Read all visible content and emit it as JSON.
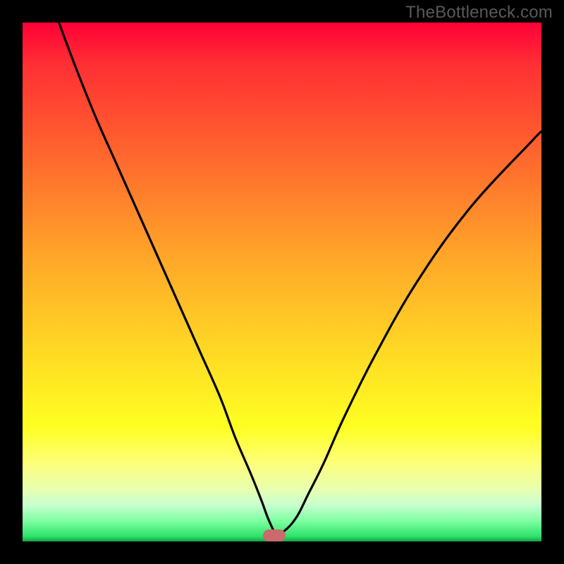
{
  "watermark": "TheBottleneck.com",
  "colors": {
    "frame": "#000000",
    "watermark": "#595959",
    "curve_stroke": "#000000",
    "bump": "#cb6a6c",
    "gradient_stops": [
      "#ff0037",
      "#ff2f34",
      "#ff5b2f",
      "#ffa629",
      "#ffe024",
      "#ffff22",
      "#fdff7b",
      "#e7ffb1",
      "#c7ffce",
      "#7fffa2",
      "#2de36b",
      "#16a342"
    ]
  },
  "chart_data": {
    "type": "line",
    "title": "",
    "xlabel": "",
    "ylabel": "",
    "xlim": [
      0,
      100
    ],
    "ylim": [
      0,
      100
    ],
    "grid": false,
    "legend": false,
    "series": [
      {
        "name": "bottleneck-curve",
        "x": [
          7,
          10,
          14,
          18,
          22,
          26,
          30,
          34,
          38,
          41,
          44,
          46,
          47.5,
          49,
          51,
          53,
          55,
          58,
          62,
          68,
          76,
          86,
          98,
          100
        ],
        "y": [
          100,
          92,
          82,
          73,
          64,
          55,
          46,
          37,
          28,
          20,
          13,
          8,
          4,
          1.5,
          2.5,
          5,
          9,
          15,
          24,
          36,
          50,
          64,
          77,
          79
        ]
      }
    ],
    "markers": [
      {
        "name": "optimal-point",
        "x": 48.5,
        "y": 1.2,
        "shape": "pill",
        "color": "#cb6a6c"
      }
    ]
  }
}
